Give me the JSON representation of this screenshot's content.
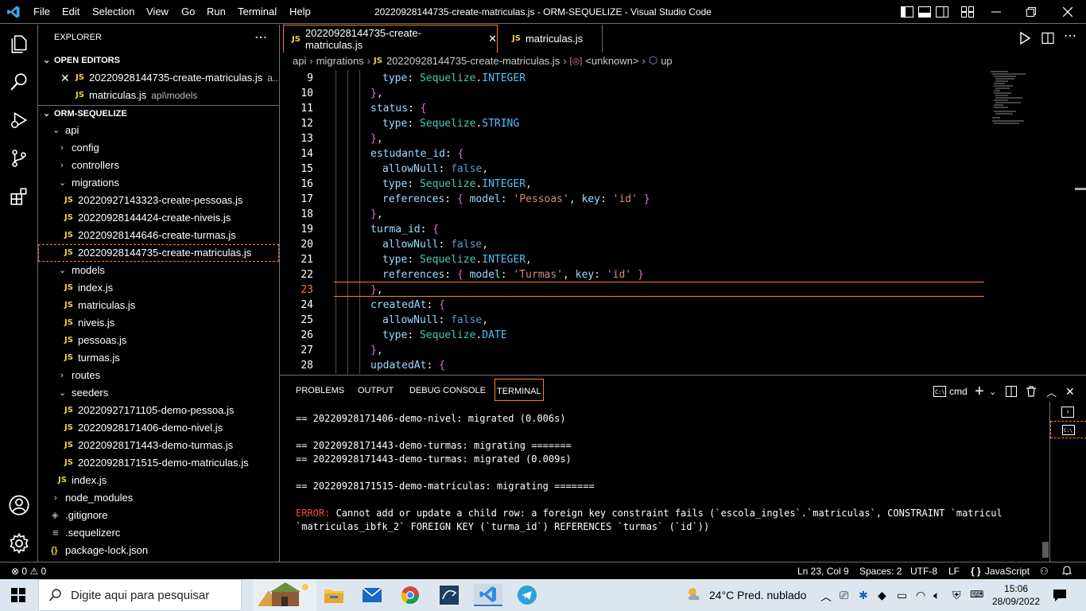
{
  "titlebar": {
    "menu": [
      "File",
      "Edit",
      "Selection",
      "View",
      "Go",
      "Run",
      "Terminal",
      "Help"
    ],
    "title": "20220928144735-create-matriculas.js - ORM-SEQUELIZE - Visual Studio Code"
  },
  "explorer": {
    "header": "EXPLORER",
    "open_editors_label": "OPEN EDITORS",
    "open_editors": [
      {
        "name": "20220928144735-create-matriculas.js",
        "desc": "a..."
      },
      {
        "name": "matriculas.js",
        "desc": "api\\models"
      }
    ],
    "project_label": "ORM-SEQUELIZE",
    "tree": {
      "api": "api",
      "config": "config",
      "controllers": "controllers",
      "migrations": "migrations",
      "migration_files": [
        "20220927143323-create-pessoas.js",
        "20220928144424-create-niveis.js",
        "20220928144646-create-turmas.js",
        "20220928144735-create-matriculas.js"
      ],
      "models": "models",
      "model_files": [
        "index.js",
        "matriculas.js",
        "niveis.js",
        "pessoas.js",
        "turmas.js"
      ],
      "routes": "routes",
      "seeders": "seeders",
      "seeder_files": [
        "20220927171105-demo-pessoa.js",
        "20220928171406-demo-nivel.js",
        "20220928171443-demo-turmas.js",
        "20220928171515-demo-matriculas.js"
      ],
      "api_index": "index.js",
      "node_modules": "node_modules",
      "gitignore": ".gitignore",
      "sequelizerc": ".sequelizerc",
      "package_lock": "package-lock.json"
    }
  },
  "tabs": [
    {
      "label": "20220928144735-create-matriculas.js"
    },
    {
      "label": "matriculas.js"
    }
  ],
  "breadcrumb": [
    "api",
    "migrations",
    "20220928144735-create-matriculas.js",
    "<unknown>",
    "up"
  ],
  "editor": {
    "lines": [
      {
        "n": "9",
        "text": "type: Sequelize.INTEGER"
      },
      {
        "n": "10",
        "text": "},"
      },
      {
        "n": "11",
        "text": "status: {"
      },
      {
        "n": "12",
        "text": "type: Sequelize.STRING"
      },
      {
        "n": "13",
        "text": "},"
      },
      {
        "n": "14",
        "text": "estudante_id: {"
      },
      {
        "n": "15",
        "text": "allowNull: false,"
      },
      {
        "n": "16",
        "text": "type: Sequelize.INTEGER,"
      },
      {
        "n": "17",
        "text": "references: { model: 'Pessoas', key: 'id' }"
      },
      {
        "n": "18",
        "text": "},"
      },
      {
        "n": "19",
        "text": "turma_id: {"
      },
      {
        "n": "20",
        "text": "allowNull: false,"
      },
      {
        "n": "21",
        "text": "type: Sequelize.INTEGER,"
      },
      {
        "n": "22",
        "text": "references: { model: 'Turmas', key: 'id' }"
      },
      {
        "n": "23",
        "text": "},"
      },
      {
        "n": "24",
        "text": "createdAt: {"
      },
      {
        "n": "25",
        "text": "allowNull: false,"
      },
      {
        "n": "26",
        "text": "type: Sequelize.DATE"
      },
      {
        "n": "27",
        "text": "},"
      },
      {
        "n": "28",
        "text": "updatedAt: {"
      }
    ]
  },
  "panel": {
    "tabs": [
      "PROBLEMS",
      "OUTPUT",
      "DEBUG CONSOLE",
      "TERMINAL"
    ],
    "shell": "cmd",
    "terminal_lines": [
      {
        "text": "== 20220928171406-demo-nivel: migrated (0.006s)",
        "type": "normal"
      },
      {
        "text": "",
        "type": "normal"
      },
      {
        "text": "== 20220928171443-demo-turmas: migrating =======",
        "type": "normal"
      },
      {
        "text": "== 20220928171443-demo-turmas: migrated (0.009s)",
        "type": "normal"
      },
      {
        "text": "",
        "type": "normal"
      },
      {
        "text": "== 20220928171515-demo-matriculas: migrating =======",
        "type": "normal"
      },
      {
        "text": "",
        "type": "normal"
      },
      {
        "prefix": "ERROR:",
        "text": " Cannot add or update a child row: a foreign key constraint fails (`escola_ingles`.`matriculas`, CONSTRAINT `matricul",
        "type": "error"
      },
      {
        "text": "`matriculas_ibfk_2` FOREIGN KEY (`turma_id`) REFERENCES `turmas` (`id`))",
        "type": "normal"
      }
    ]
  },
  "statusbar": {
    "errors": "0",
    "warnings": "0",
    "position": "Ln 23, Col 9",
    "spaces": "Spaces: 2",
    "encoding": "UTF-8",
    "eol": "LF",
    "language": "JavaScript"
  },
  "taskbar": {
    "search_placeholder": "Digite aqui para pesquisar",
    "weather": "24°C  Pred. nublado",
    "time": "15:06",
    "date": "28/09/2022"
  }
}
